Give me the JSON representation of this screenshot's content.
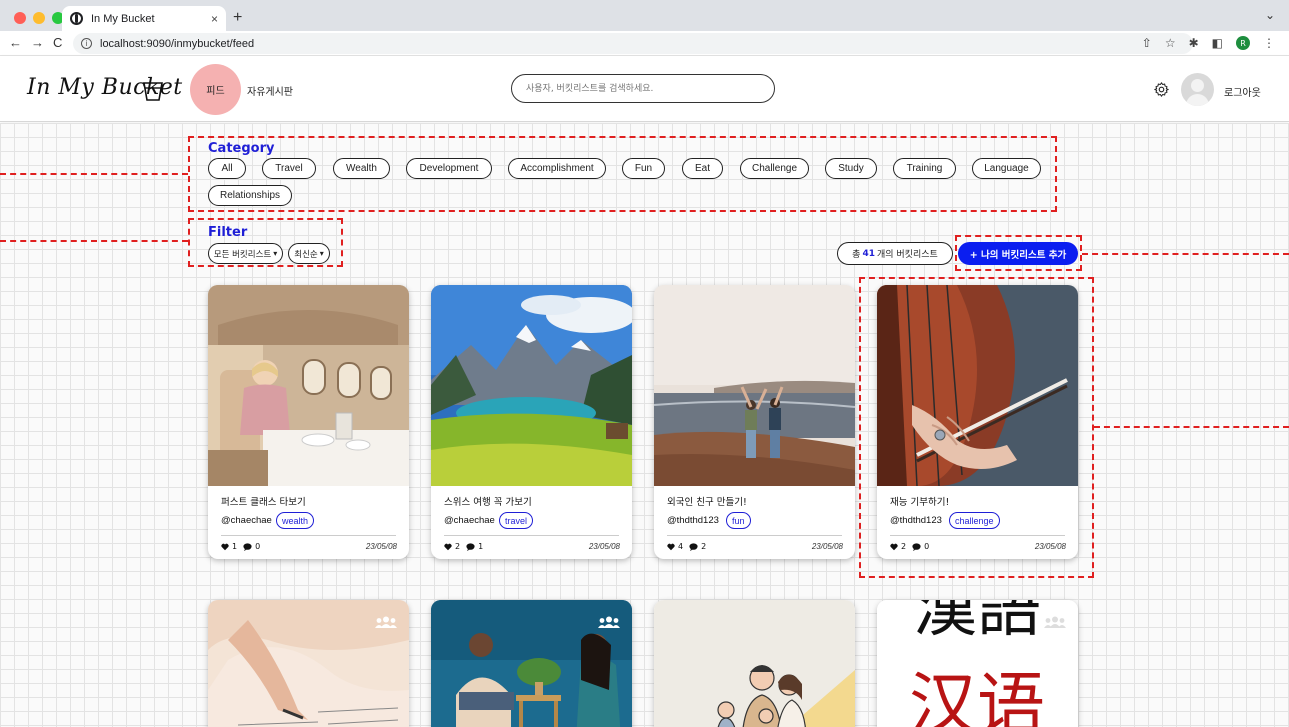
{
  "browser": {
    "tab_title": "In My Bucket",
    "tab_close": "×",
    "new_tab": "+",
    "url": "localhost:9090/inmybucket/feed",
    "profile_initial": "R"
  },
  "header": {
    "logo": "In My Bucket",
    "nav_feed": "피드",
    "nav_board": "자유게시판",
    "search_placeholder": "사용자, 버킷리스트를 검색하세요.",
    "logout": "로그아웃"
  },
  "category": {
    "title": "Category",
    "items": [
      "All",
      "Travel",
      "Wealth",
      "Development",
      "Accomplishment",
      "Fun",
      "Eat",
      "Challenge",
      "Study",
      "Training",
      "Language",
      "Relationships"
    ]
  },
  "filter": {
    "title": "Filter",
    "scope_select": "모든 버킷리스트",
    "sort_select": "최신순"
  },
  "summary": {
    "prefix": "총",
    "count": "41",
    "suffix": "개의 버킷리스트",
    "add_button": "+ 나의 버킷리스트 추가"
  },
  "cards": [
    {
      "title": "퍼스트 클래스 타보기",
      "user": "@chaechae",
      "tag": "wealth",
      "likes": "1",
      "comments": "0",
      "date": "23/05/08"
    },
    {
      "title": "스위스 여행 꼭 가보기",
      "user": "@chaechae",
      "tag": "travel",
      "likes": "2",
      "comments": "1",
      "date": "23/05/08"
    },
    {
      "title": "외국인 친구 만들기!",
      "user": "@thdthd123",
      "tag": "fun",
      "likes": "4",
      "comments": "2",
      "date": "23/05/08"
    },
    {
      "title": "재능 기부하기!",
      "user": "@thdthd123",
      "tag": "challenge",
      "likes": "2",
      "comments": "0",
      "date": "23/05/08"
    }
  ],
  "second_row": {
    "card4_text_top": "漢語",
    "card4_text_bottom": "汉语"
  },
  "colors": {
    "accent_blue": "#1f1fd6",
    "add_button": "#0b1ef0",
    "feed_highlight": "#f5b1b1",
    "annotation_red": "#e02020"
  }
}
